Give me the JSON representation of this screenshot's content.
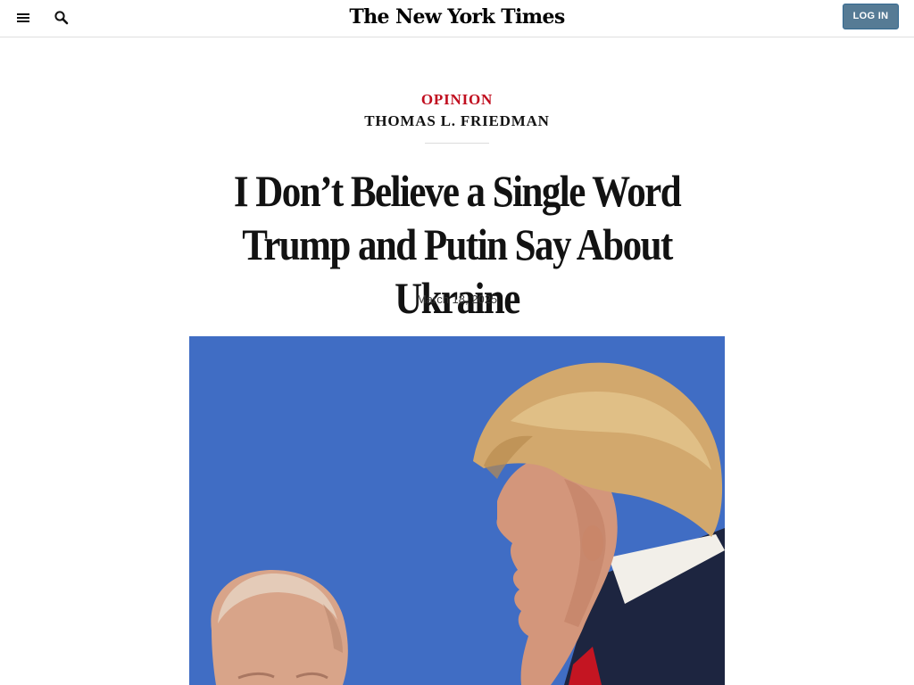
{
  "header": {
    "masthead": "The New York Times",
    "login_label": "LOG IN",
    "icons": {
      "menu": "hamburger-menu-icon",
      "search": "search-icon"
    }
  },
  "article": {
    "section": "OPINION",
    "author": "THOMAS L. FRIEDMAN",
    "headline": "I Don’t Believe a Single Word Trump and Putin Say About Ukraine",
    "date": "March 18, 2025"
  },
  "colors": {
    "section_red": "#c00d1e",
    "login_blue": "#567b95",
    "photo_background_blue": "#4270c8"
  }
}
